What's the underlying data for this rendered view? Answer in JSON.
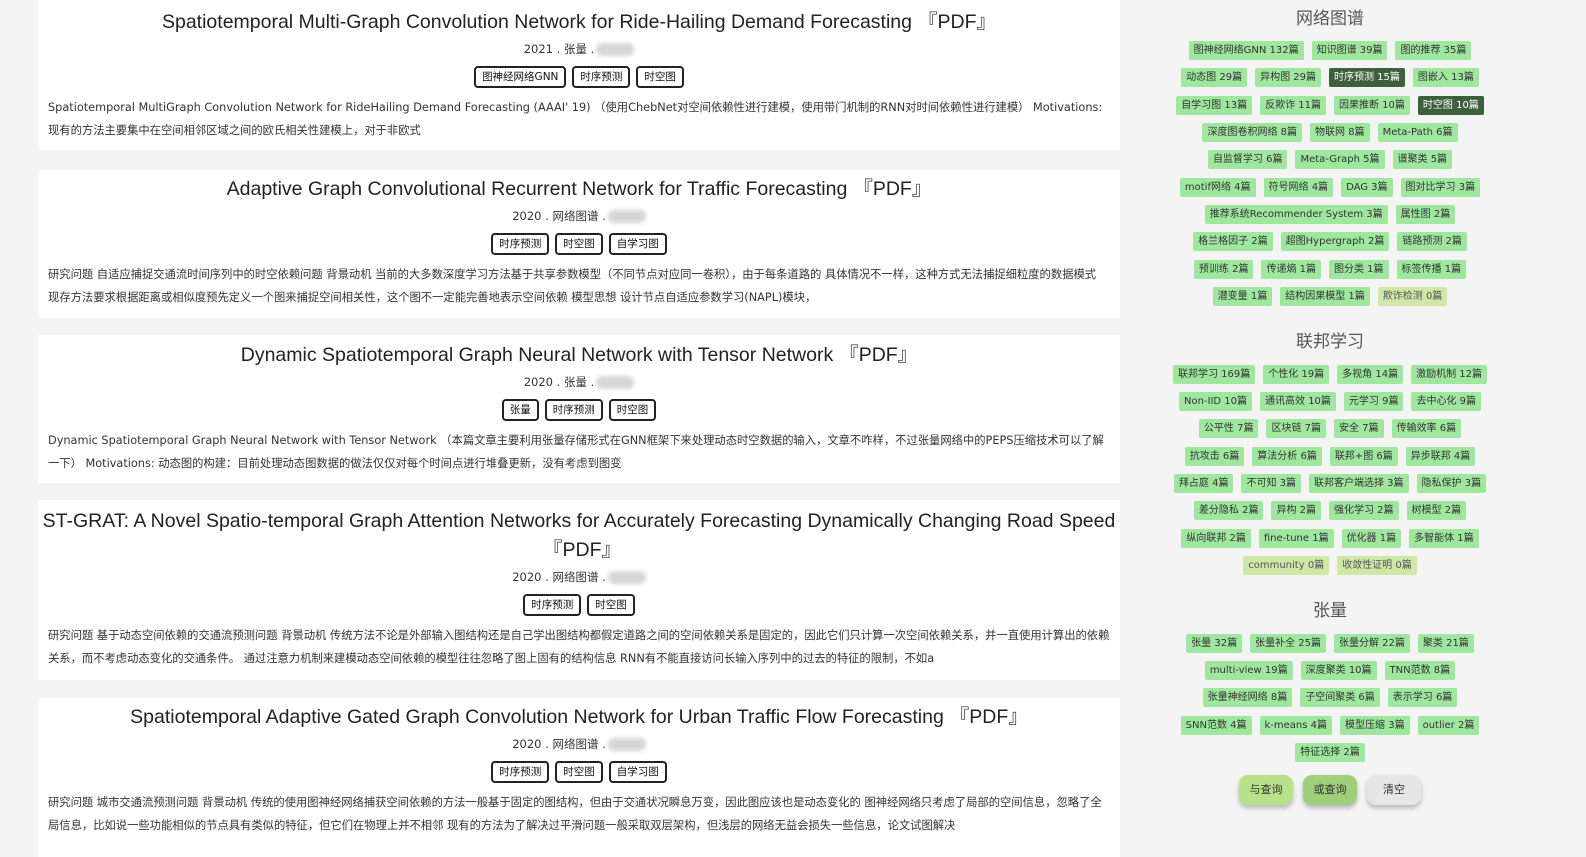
{
  "papers": [
    {
      "title": "Spatiotemporal Multi-Graph Convolution Network for Ride-Hailing Demand Forecasting",
      "pdf": "『PDF』",
      "meta": "2021 . 张量 .",
      "tags": [
        "图神经网络GNN",
        "时序预测",
        "时空图"
      ],
      "abstract": "Spatiotemporal MultiGraph Convolution Network for RideHailing Demand Forecasting (AAAI' 19) （使用ChebNet对空间依赖性进行建模，使用带门机制的RNN对时间依赖性进行建模） Motivations: 现有的方法主要集中在空间相邻区域之间的欧氏相关性建模上，对于非欧式"
    },
    {
      "title": "Adaptive Graph Convolutional Recurrent Network for Traffic Forecasting",
      "pdf": "『PDF』",
      "meta": "2020 . 网络图谱 .",
      "tags": [
        "时序预测",
        "时空图",
        "自学习图"
      ],
      "abstract": "研究问题 自适应捕捉交通流时间序列中的时空依赖问题 背景动机 当前的大多数深度学习方法基于共享参数模型（不同节点对应同一卷积），由于每条道路的 具体情况不一样，这种方式无法捕捉细粒度的数据模式 现存方法要求根据距离或相似度预先定义一个图来捕捉空间相关性，这个图不一定能完善地表示空间依赖 模型思想 设计节点自适应参数学习(NAPL)模块，"
    },
    {
      "title": "Dynamic Spatiotemporal Graph Neural Network with Tensor Network",
      "pdf": "『PDF』",
      "meta": "2020 . 张量 .",
      "tags": [
        "张量",
        "时序预测",
        "时空图"
      ],
      "abstract": "Dynamic Spatiotemporal Graph Neural Network with Tensor Network （本篇文章主要利用张量存储形式在GNN框架下来处理动态时空数据的输入，文章不咋样，不过张量网络中的PEPS压缩技术可以了解一下） Motivations: 动态图的构建：目前处理动态图数据的做法仅仅对每个时间点进行堆叠更新，没有考虑到图变"
    },
    {
      "title": "ST-GRAT: A Novel Spatio-temporal Graph Attention Networks for Accurately Forecasting Dynamically Changing Road Speed",
      "pdf": "『PDF』",
      "meta": "2020 . 网络图谱 .",
      "tags": [
        "时序预测",
        "时空图"
      ],
      "abstract": "研究问题 基于动态空间依赖的交通流预测问题 背景动机 传统方法不论是外部输入图结构还是自己学出图结构都假定道路之间的空间依赖关系是固定的，因此它们只计算一次空间依赖关系，并一直使用计算出的依赖关系，而不考虑动态变化的交通条件。 通过注意力机制来建模动态空间依赖的模型往往忽略了图上固有的结构信息 RNN有不能直接访问长输入序列中的过去的特征的限制，不如a"
    },
    {
      "title": "Spatiotemporal Adaptive Gated Graph Convolution Network for Urban Traffic Flow Forecasting",
      "pdf": "『PDF』",
      "meta": "2020 . 网络图谱 .",
      "tags": [
        "时序预测",
        "时空图",
        "自学习图"
      ],
      "abstract": "研究问题 城市交通流预测问题 背景动机 传统的使用图神经网络捕获空间依赖的方法一般基于固定的图结构，但由于交通状况瞬息万变，因此图应该也是动态变化的 图神经网络只考虑了局部的空间信息，忽略了全局信息，比如说一些功能相似的节点具有类似的特征，但它们在物理上并不相邻 现有的方法为了解决过平滑问题一般采取双层架构，但浅层的网络无益会损失一些信息，论文试图解决"
    }
  ],
  "sidebar": {
    "sections": [
      {
        "title": "网络图谱",
        "rows": [
          [
            {
              "t": "图神经网络GNN 132篇"
            },
            {
              "t": "知识图谱 39篇"
            },
            {
              "t": "图的推荐 35篇"
            }
          ],
          [
            {
              "t": "动态图 29篇"
            },
            {
              "t": "异构图 29篇"
            },
            {
              "t": "时序预测 15篇",
              "s": "sel"
            },
            {
              "t": "图嵌入 13篇"
            }
          ],
          [
            {
              "t": "自学习图 13篇"
            },
            {
              "t": "反欺诈 11篇"
            },
            {
              "t": "因果推断 10篇"
            },
            {
              "t": "时空图 10篇",
              "s": "sel"
            }
          ],
          [
            {
              "t": "深度图卷积网络 8篇"
            },
            {
              "t": "物联网 8篇"
            },
            {
              "t": "Meta-Path 6篇"
            }
          ],
          [
            {
              "t": "自监督学习 6篇"
            },
            {
              "t": "Meta-Graph 5篇"
            },
            {
              "t": "谱聚类 5篇"
            }
          ],
          [
            {
              "t": "motif网络 4篇"
            },
            {
              "t": "符号网络 4篇"
            },
            {
              "t": "DAG 3篇"
            },
            {
              "t": "图对比学习 3篇"
            }
          ],
          [
            {
              "t": "推荐系统Recommender System 3篇"
            },
            {
              "t": "属性图 2篇"
            }
          ],
          [
            {
              "t": "格兰格因子 2篇"
            },
            {
              "t": "超图Hypergraph 2篇"
            },
            {
              "t": "链路预测 2篇"
            }
          ],
          [
            {
              "t": "预训练 2篇"
            },
            {
              "t": "传递熵 1篇"
            },
            {
              "t": "图分类 1篇"
            },
            {
              "t": "标签传播 1篇"
            }
          ],
          [
            {
              "t": "潜变量 1篇"
            },
            {
              "t": "结构因果模型 1篇"
            },
            {
              "t": "欺诈检测 0篇",
              "s": "zero"
            }
          ]
        ]
      },
      {
        "title": "联邦学习",
        "rows": [
          [
            {
              "t": "联邦学习 169篇"
            },
            {
              "t": "个性化 19篇"
            },
            {
              "t": "多视角 14篇"
            },
            {
              "t": "激励机制 12篇"
            }
          ],
          [
            {
              "t": "Non-IID 10篇"
            },
            {
              "t": "通讯高效 10篇"
            },
            {
              "t": "元学习 9篇"
            },
            {
              "t": "去中心化 9篇"
            }
          ],
          [
            {
              "t": "公平性 7篇"
            },
            {
              "t": "区块链 7篇"
            },
            {
              "t": "安全 7篇"
            },
            {
              "t": "传输效率 6篇"
            }
          ],
          [
            {
              "t": "抗攻击 6篇"
            },
            {
              "t": "算法分析 6篇"
            },
            {
              "t": "联邦+图 6篇"
            },
            {
              "t": "异步联邦 4篇"
            }
          ],
          [
            {
              "t": "拜占庭 4篇"
            },
            {
              "t": "不可知 3篇"
            },
            {
              "t": "联邦客户端选择 3篇"
            },
            {
              "t": "隐私保护 3篇"
            }
          ],
          [
            {
              "t": "差分隐私 2篇"
            },
            {
              "t": "异构 2篇"
            },
            {
              "t": "强化学习 2篇"
            },
            {
              "t": "树模型 2篇"
            }
          ],
          [
            {
              "t": "纵向联邦 2篇"
            },
            {
              "t": "fine-tune 1篇"
            },
            {
              "t": "优化器 1篇"
            },
            {
              "t": "多智能体 1篇"
            }
          ],
          [
            {
              "t": "community 0篇",
              "s": "zero"
            },
            {
              "t": "收敛性证明 0篇",
              "s": "zero"
            }
          ]
        ]
      },
      {
        "title": "张量",
        "rows": [
          [
            {
              "t": "张量 32篇"
            },
            {
              "t": "张量补全 25篇"
            },
            {
              "t": "张量分解 22篇"
            },
            {
              "t": "聚类 21篇"
            }
          ],
          [
            {
              "t": "multi-view 19篇"
            },
            {
              "t": "深度聚类 10篇"
            },
            {
              "t": "TNN范数 8篇"
            }
          ],
          [
            {
              "t": "张量神经网络 8篇"
            },
            {
              "t": "子空间聚类 6篇"
            },
            {
              "t": "表示学习 6篇"
            }
          ],
          [
            {
              "t": "SNN范数 4篇"
            },
            {
              "t": "k-means 4篇"
            },
            {
              "t": "模型压缩 3篇"
            },
            {
              "t": "outlier 2篇"
            }
          ],
          [
            {
              "t": "特征选择 2篇"
            }
          ]
        ]
      }
    ],
    "buttons": {
      "and": "与查询",
      "or": "或查询",
      "clear": "清空"
    }
  }
}
